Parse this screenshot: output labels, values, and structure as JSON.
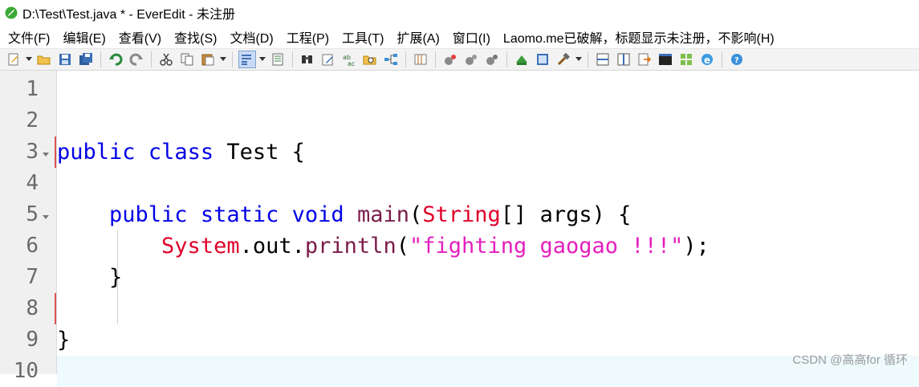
{
  "window": {
    "title": "D:\\Test\\Test.java * - EverEdit - 未注册",
    "icon": "everedit-app-icon"
  },
  "menu": {
    "items": [
      {
        "label": "文件(F)"
      },
      {
        "label": "编辑(E)"
      },
      {
        "label": "查看(V)"
      },
      {
        "label": "查找(S)"
      },
      {
        "label": "文档(D)"
      },
      {
        "label": "工程(P)"
      },
      {
        "label": "工具(T)"
      },
      {
        "label": "扩展(A)"
      },
      {
        "label": "窗口(I)"
      },
      {
        "label": "Laomo.me已破解，标题显示未注册，不影响(H)"
      }
    ]
  },
  "toolbar": {
    "icons": [
      "new-file-icon",
      "open-folder-icon",
      "save-icon",
      "save-all-icon",
      "undo-icon",
      "redo-icon",
      "cut-icon",
      "copy-icon",
      "paste-icon",
      "word-wrap-icon",
      "outline-icon",
      "find-icon",
      "find-replace-icon",
      "spell-check-icon",
      "find-in-files-icon",
      "bookmark-tree-icon",
      "column-mode-icon",
      "macro-record-icon",
      "macro-play-icon",
      "macro-stop-icon",
      "run-icon",
      "compile-icon",
      "tools-icon",
      "split-horizontal-icon",
      "split-vertical-icon",
      "export-icon",
      "terminal-icon",
      "grid-icon",
      "browser-icon",
      "help-icon"
    ]
  },
  "editor": {
    "line_numbers": [
      "1",
      "2",
      "3",
      "4",
      "5",
      "6",
      "7",
      "8",
      "9",
      "10"
    ],
    "code": {
      "l3_kw1": "public",
      "l3_kw2": "class",
      "l3_name": "Test",
      "l3_brace": "{",
      "l5_kw1": "public",
      "l5_kw2": "static",
      "l5_kw3": "void",
      "l5_method": "main",
      "l5_paren": "(",
      "l5_type": "String",
      "l5_rest": "[] args) {",
      "l6_class": "System",
      "l6_dot1": ".",
      "l6_field": "out",
      "l6_dot2": ".",
      "l6_method": "println",
      "l6_paren": "(",
      "l6_string": "\"fighting gaogao !!!\"",
      "l6_end": ");",
      "l7_brace": "}",
      "l9_brace": "}"
    },
    "colors": {
      "keyword": "#0000e6",
      "method": "#7a1c4a",
      "class": "#e0002a",
      "string": "#e31fbd"
    }
  },
  "watermark": "CSDN @高高for 循环"
}
